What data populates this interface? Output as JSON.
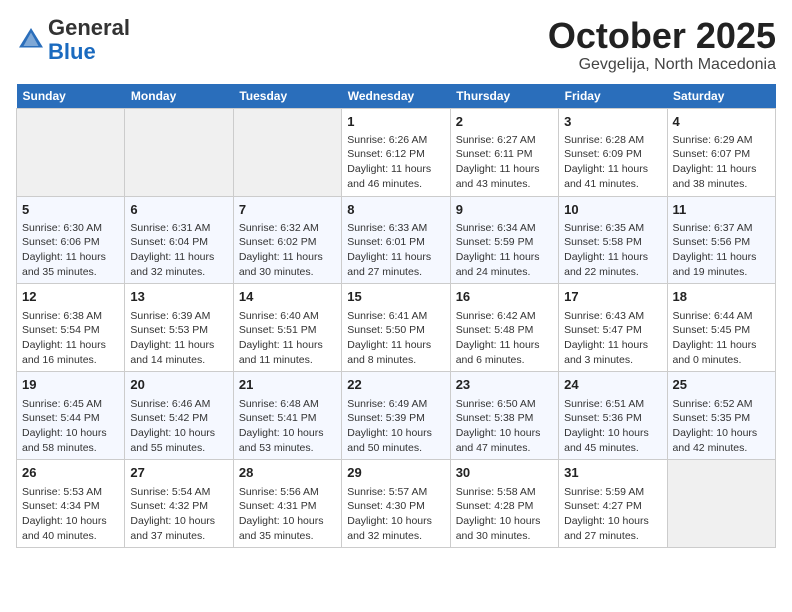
{
  "header": {
    "logo_line1": "General",
    "logo_line2": "Blue",
    "month": "October 2025",
    "location": "Gevgelija, North Macedonia"
  },
  "days_of_week": [
    "Sunday",
    "Monday",
    "Tuesday",
    "Wednesday",
    "Thursday",
    "Friday",
    "Saturday"
  ],
  "weeks": [
    {
      "days": [
        {
          "num": "",
          "info": ""
        },
        {
          "num": "",
          "info": ""
        },
        {
          "num": "",
          "info": ""
        },
        {
          "num": "1",
          "info": "Sunrise: 6:26 AM\nSunset: 6:12 PM\nDaylight: 11 hours and 46 minutes."
        },
        {
          "num": "2",
          "info": "Sunrise: 6:27 AM\nSunset: 6:11 PM\nDaylight: 11 hours and 43 minutes."
        },
        {
          "num": "3",
          "info": "Sunrise: 6:28 AM\nSunset: 6:09 PM\nDaylight: 11 hours and 41 minutes."
        },
        {
          "num": "4",
          "info": "Sunrise: 6:29 AM\nSunset: 6:07 PM\nDaylight: 11 hours and 38 minutes."
        }
      ]
    },
    {
      "days": [
        {
          "num": "5",
          "info": "Sunrise: 6:30 AM\nSunset: 6:06 PM\nDaylight: 11 hours and 35 minutes."
        },
        {
          "num": "6",
          "info": "Sunrise: 6:31 AM\nSunset: 6:04 PM\nDaylight: 11 hours and 32 minutes."
        },
        {
          "num": "7",
          "info": "Sunrise: 6:32 AM\nSunset: 6:02 PM\nDaylight: 11 hours and 30 minutes."
        },
        {
          "num": "8",
          "info": "Sunrise: 6:33 AM\nSunset: 6:01 PM\nDaylight: 11 hours and 27 minutes."
        },
        {
          "num": "9",
          "info": "Sunrise: 6:34 AM\nSunset: 5:59 PM\nDaylight: 11 hours and 24 minutes."
        },
        {
          "num": "10",
          "info": "Sunrise: 6:35 AM\nSunset: 5:58 PM\nDaylight: 11 hours and 22 minutes."
        },
        {
          "num": "11",
          "info": "Sunrise: 6:37 AM\nSunset: 5:56 PM\nDaylight: 11 hours and 19 minutes."
        }
      ]
    },
    {
      "days": [
        {
          "num": "12",
          "info": "Sunrise: 6:38 AM\nSunset: 5:54 PM\nDaylight: 11 hours and 16 minutes."
        },
        {
          "num": "13",
          "info": "Sunrise: 6:39 AM\nSunset: 5:53 PM\nDaylight: 11 hours and 14 minutes."
        },
        {
          "num": "14",
          "info": "Sunrise: 6:40 AM\nSunset: 5:51 PM\nDaylight: 11 hours and 11 minutes."
        },
        {
          "num": "15",
          "info": "Sunrise: 6:41 AM\nSunset: 5:50 PM\nDaylight: 11 hours and 8 minutes."
        },
        {
          "num": "16",
          "info": "Sunrise: 6:42 AM\nSunset: 5:48 PM\nDaylight: 11 hours and 6 minutes."
        },
        {
          "num": "17",
          "info": "Sunrise: 6:43 AM\nSunset: 5:47 PM\nDaylight: 11 hours and 3 minutes."
        },
        {
          "num": "18",
          "info": "Sunrise: 6:44 AM\nSunset: 5:45 PM\nDaylight: 11 hours and 0 minutes."
        }
      ]
    },
    {
      "days": [
        {
          "num": "19",
          "info": "Sunrise: 6:45 AM\nSunset: 5:44 PM\nDaylight: 10 hours and 58 minutes."
        },
        {
          "num": "20",
          "info": "Sunrise: 6:46 AM\nSunset: 5:42 PM\nDaylight: 10 hours and 55 minutes."
        },
        {
          "num": "21",
          "info": "Sunrise: 6:48 AM\nSunset: 5:41 PM\nDaylight: 10 hours and 53 minutes."
        },
        {
          "num": "22",
          "info": "Sunrise: 6:49 AM\nSunset: 5:39 PM\nDaylight: 10 hours and 50 minutes."
        },
        {
          "num": "23",
          "info": "Sunrise: 6:50 AM\nSunset: 5:38 PM\nDaylight: 10 hours and 47 minutes."
        },
        {
          "num": "24",
          "info": "Sunrise: 6:51 AM\nSunset: 5:36 PM\nDaylight: 10 hours and 45 minutes."
        },
        {
          "num": "25",
          "info": "Sunrise: 6:52 AM\nSunset: 5:35 PM\nDaylight: 10 hours and 42 minutes."
        }
      ]
    },
    {
      "days": [
        {
          "num": "26",
          "info": "Sunrise: 5:53 AM\nSunset: 4:34 PM\nDaylight: 10 hours and 40 minutes."
        },
        {
          "num": "27",
          "info": "Sunrise: 5:54 AM\nSunset: 4:32 PM\nDaylight: 10 hours and 37 minutes."
        },
        {
          "num": "28",
          "info": "Sunrise: 5:56 AM\nSunset: 4:31 PM\nDaylight: 10 hours and 35 minutes."
        },
        {
          "num": "29",
          "info": "Sunrise: 5:57 AM\nSunset: 4:30 PM\nDaylight: 10 hours and 32 minutes."
        },
        {
          "num": "30",
          "info": "Sunrise: 5:58 AM\nSunset: 4:28 PM\nDaylight: 10 hours and 30 minutes."
        },
        {
          "num": "31",
          "info": "Sunrise: 5:59 AM\nSunset: 4:27 PM\nDaylight: 10 hours and 27 minutes."
        },
        {
          "num": "",
          "info": ""
        }
      ]
    }
  ]
}
